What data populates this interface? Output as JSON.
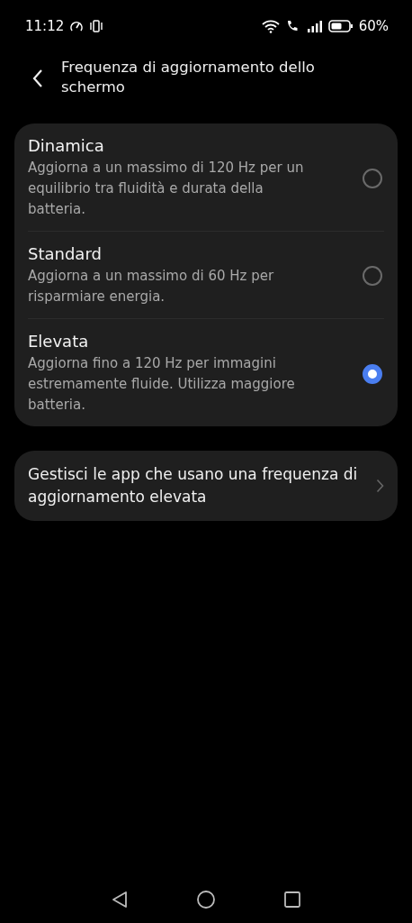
{
  "status_bar": {
    "time": "11:12",
    "battery": "60%"
  },
  "header": {
    "title": "Frequenza di aggiornamento dello schermo"
  },
  "options": [
    {
      "title": "Dinamica",
      "description": "Aggiorna a un massimo di 120 Hz per un equilibrio tra fluidità e durata della batteria.",
      "selected": false
    },
    {
      "title": "Standard",
      "description": "Aggiorna a un massimo di 60 Hz per risparmiare energia.",
      "selected": false
    },
    {
      "title": "Elevata",
      "description": "Aggiorna fino a 120 Hz per immagini estremamente fluide. Utilizza maggiore batteria.",
      "selected": true
    }
  ],
  "link_item": {
    "label": "Gestisci le app che usano una frequenza di aggiornamento elevata"
  }
}
